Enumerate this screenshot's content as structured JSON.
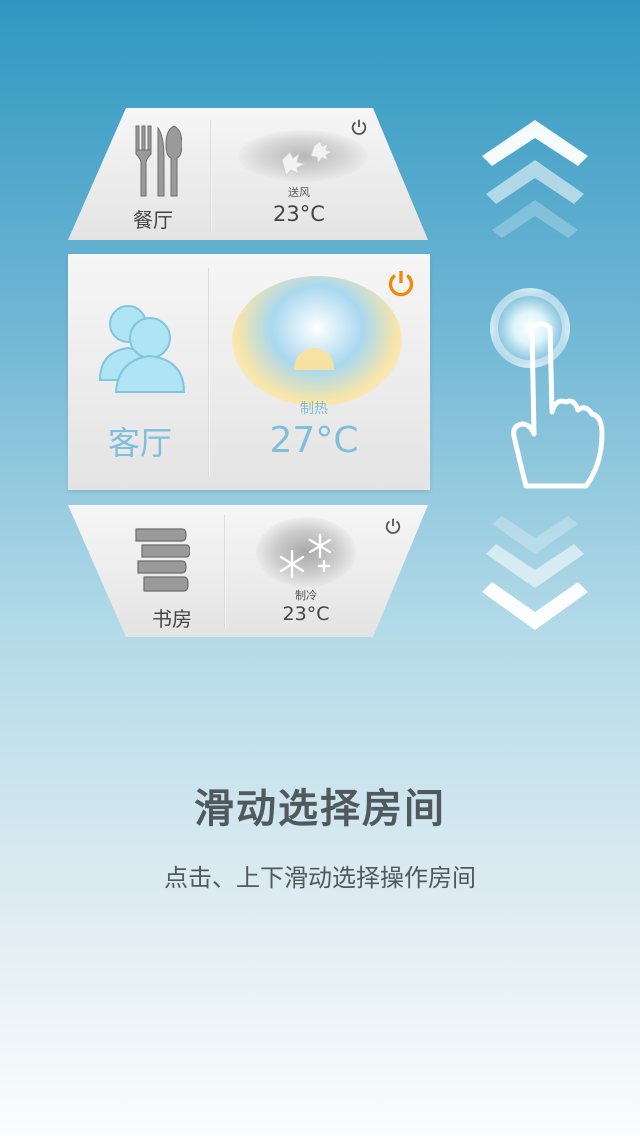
{
  "rooms": [
    {
      "name": "餐厅",
      "mode": "送风",
      "temp": "23°C",
      "icon": "fork-knife-icon",
      "power_on": false
    },
    {
      "name": "客厅",
      "mode": "制热",
      "temp": "27°C",
      "icon": "people-icon",
      "power_on": true
    },
    {
      "name": "书房",
      "mode": "制冷",
      "temp": "23°C",
      "icon": "books-icon",
      "power_on": false
    }
  ],
  "guide": {
    "title": "滑动选择房间",
    "subtitle": "点击、上下滑动选择操作房间"
  },
  "colors": {
    "power_active": "#f08a00",
    "power_inactive": "#555555",
    "accent_blue": "#7fc0de"
  }
}
